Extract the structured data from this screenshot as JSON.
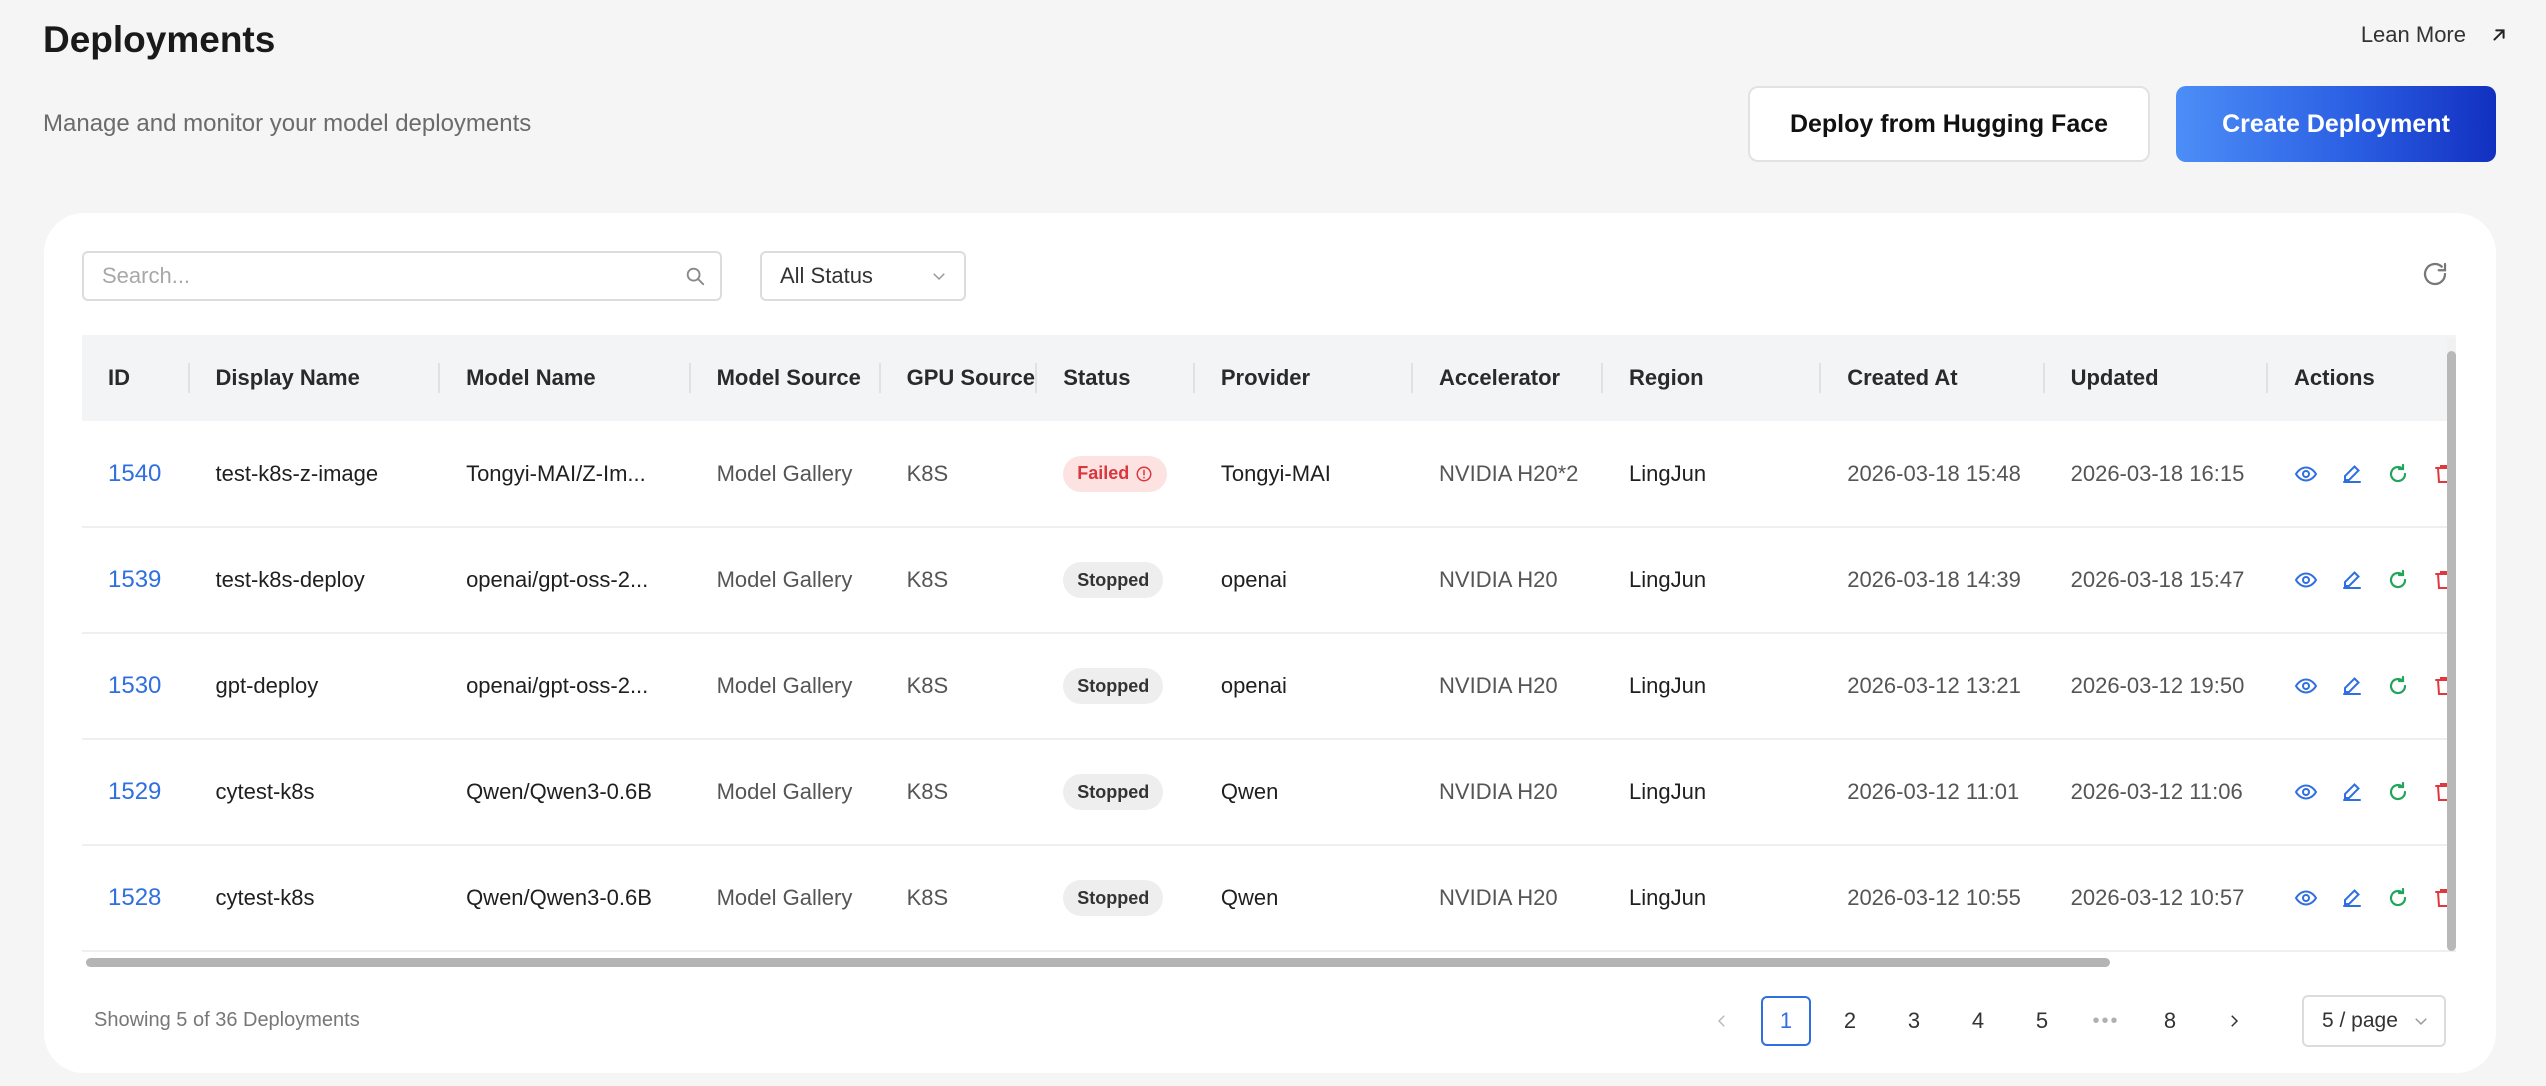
{
  "header": {
    "title": "Deployments",
    "subtitle": "Manage and monitor your model deployments",
    "learn_more": "Lean More",
    "deploy_hf_label": "Deploy from Hugging Face",
    "create_label": "Create Deployment"
  },
  "toolbar": {
    "search_placeholder": "Search...",
    "status_filter": "All Status"
  },
  "table": {
    "columns": [
      "ID",
      "Display Name",
      "Model Name",
      "Model Source",
      "GPU Source",
      "Status",
      "Provider",
      "Accelerator",
      "Region",
      "Created At",
      "Updated",
      "Actions"
    ],
    "rows": [
      {
        "id": "1540",
        "display_name": "test-k8s-z-image",
        "model_name": "Tongyi-MAI/Z-Im...",
        "model_source": "Model Gallery",
        "gpu_source": "K8S",
        "status": "Failed",
        "provider": "Tongyi-MAI",
        "accelerator": "NVIDIA H20*2",
        "region": "LingJun",
        "created_at": "2026-03-18 15:48",
        "updated": "2026-03-18 16:15"
      },
      {
        "id": "1539",
        "display_name": "test-k8s-deploy",
        "model_name": "openai/gpt-oss-2...",
        "model_source": "Model Gallery",
        "gpu_source": "K8S",
        "status": "Stopped",
        "provider": "openai",
        "accelerator": "NVIDIA H20",
        "region": "LingJun",
        "created_at": "2026-03-18 14:39",
        "updated": "2026-03-18 15:47"
      },
      {
        "id": "1530",
        "display_name": "gpt-deploy",
        "model_name": "openai/gpt-oss-2...",
        "model_source": "Model Gallery",
        "gpu_source": "K8S",
        "status": "Stopped",
        "provider": "openai",
        "accelerator": "NVIDIA H20",
        "region": "LingJun",
        "created_at": "2026-03-12 13:21",
        "updated": "2026-03-12 19:50"
      },
      {
        "id": "1529",
        "display_name": "cytest-k8s",
        "model_name": "Qwen/Qwen3-0.6B",
        "model_source": "Model Gallery",
        "gpu_source": "K8S",
        "status": "Stopped",
        "provider": "Qwen",
        "accelerator": "NVIDIA H20",
        "region": "LingJun",
        "created_at": "2026-03-12 11:01",
        "updated": "2026-03-12 11:06"
      },
      {
        "id": "1528",
        "display_name": "cytest-k8s",
        "model_name": "Qwen/Qwen3-0.6B",
        "model_source": "Model Gallery",
        "gpu_source": "K8S",
        "status": "Stopped",
        "provider": "Qwen",
        "accelerator": "NVIDIA H20",
        "region": "LingJun",
        "created_at": "2026-03-12 10:55",
        "updated": "2026-03-12 10:57"
      }
    ],
    "action_icons": [
      "view-icon",
      "edit-icon",
      "restart-icon",
      "delete-icon"
    ]
  },
  "footer": {
    "count_text": "Showing 5 of 36 Deployments",
    "pages": [
      "1",
      "2",
      "3",
      "4",
      "5",
      "•••",
      "8"
    ],
    "active_page": "1",
    "page_size": "5 / page"
  },
  "colors": {
    "accent": "#2f6fe0",
    "failed": "#d9363e",
    "restart": "#22a55a",
    "delete": "#e0383e"
  }
}
